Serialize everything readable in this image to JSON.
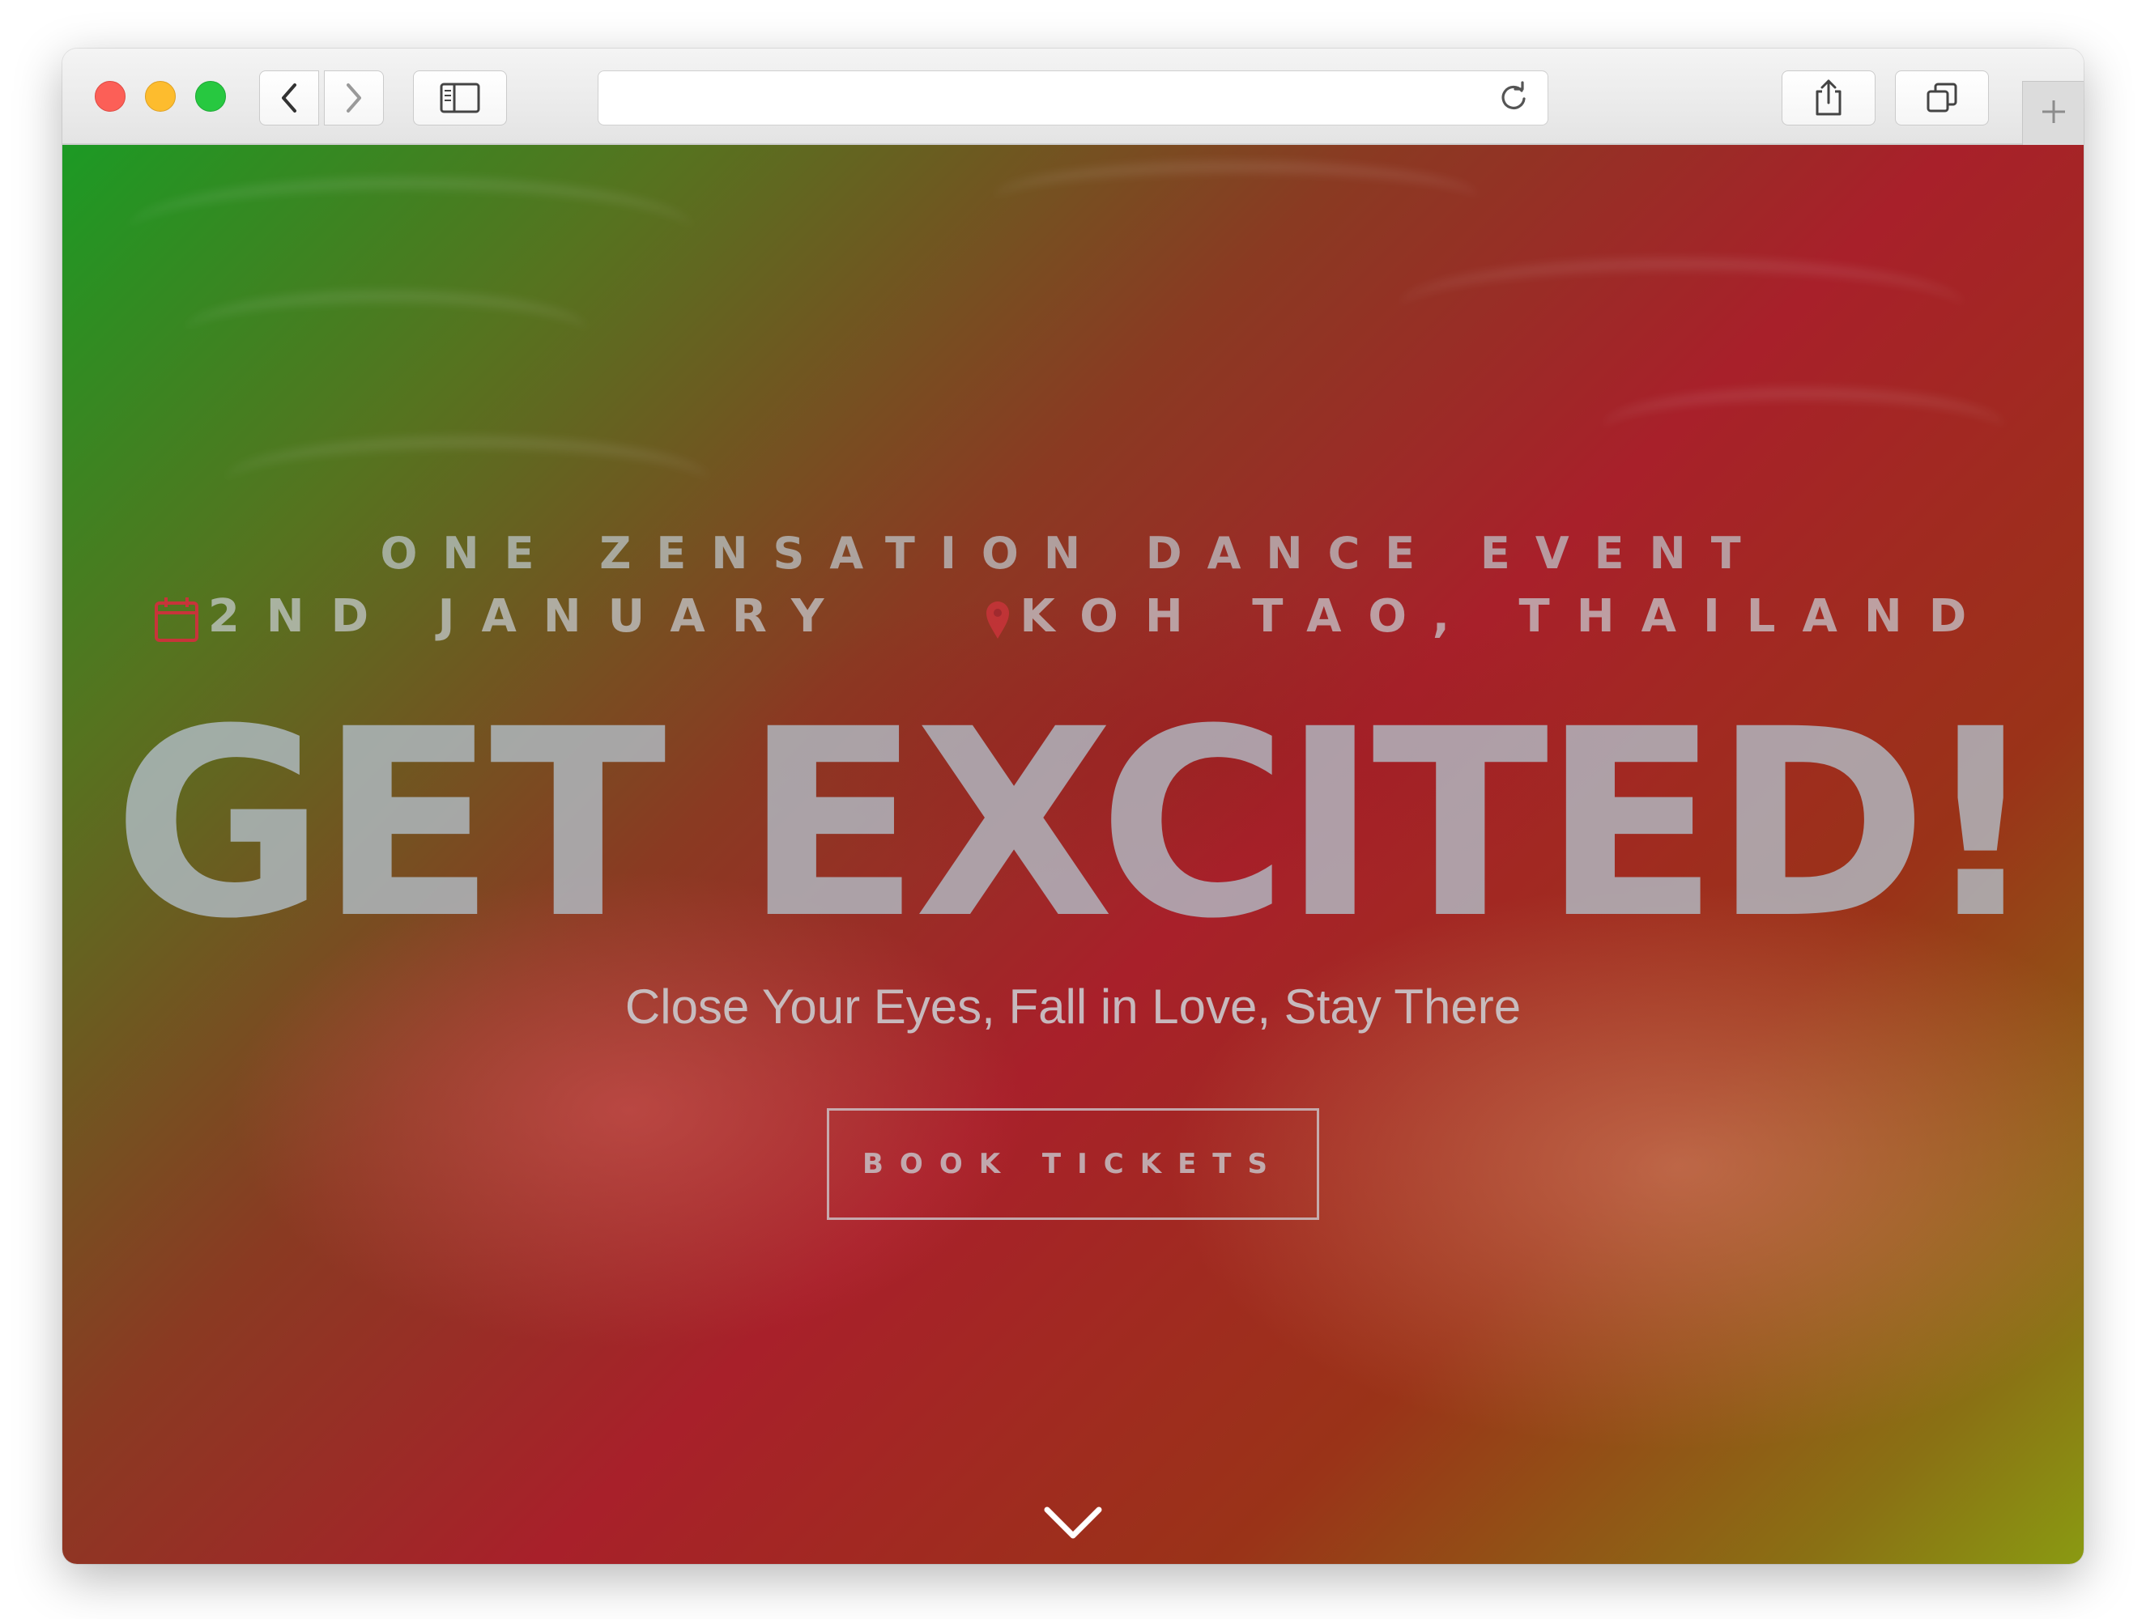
{
  "browser": {
    "url": "",
    "icons": {
      "back": "chevron-left-icon",
      "forward": "chevron-right-icon",
      "sidebar": "sidebar-icon",
      "reload": "reload-icon",
      "share": "share-icon",
      "tabs": "tabs-icon",
      "new_tab": "plus-icon"
    }
  },
  "hero": {
    "kicker": "ONE ZENSATION DANCE EVENT",
    "date": "2ND JANUARY",
    "location": "KOH TAO, THAILAND",
    "headline": "GET EXCITED!",
    "tagline": "Close Your Eyes, Fall in Love, Stay There",
    "cta_label": "BOOK TICKETS",
    "icons": {
      "date": "calendar-icon",
      "location": "map-pin-icon",
      "scroll": "chevron-down-icon"
    },
    "colors": {
      "overlay_top_left": "#1c9a24",
      "overlay_center": "#a8202a",
      "overlay_bottom_right": "#8a9a12",
      "accent_icon": "#c8343a"
    }
  }
}
